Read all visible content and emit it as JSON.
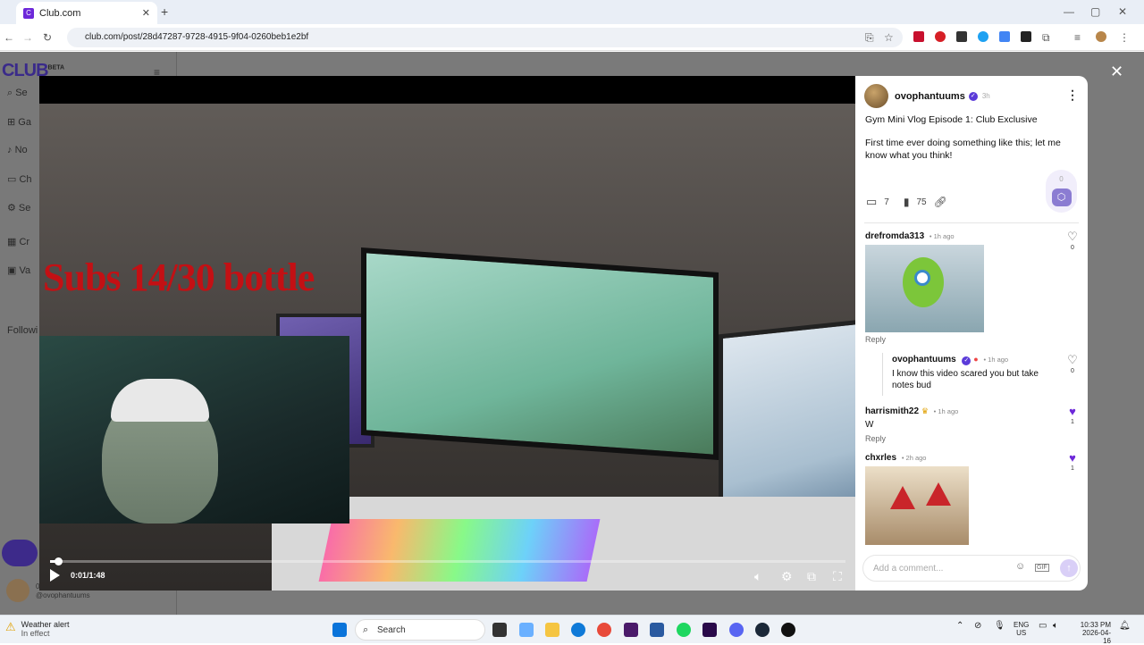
{
  "browser": {
    "tab_title": "Club.com",
    "tab_close": "✕",
    "new_tab": "+",
    "url": "club.com/post/28d47287-9728-4915-9f04-0260beb1e2bf",
    "window_min": "—",
    "window_max": "▢",
    "window_close": "✕"
  },
  "site": {
    "logo": "CLUB",
    "logo_beta": "BETA",
    "sidebar": [
      {
        "label": "Se"
      },
      {
        "label": "Ga"
      },
      {
        "label": "No"
      },
      {
        "label": "Ch"
      },
      {
        "label": "Se"
      },
      {
        "label": "Cr"
      },
      {
        "label": "Va"
      },
      {
        "label": "Followi"
      }
    ],
    "bg_username": "0",
    "bg_handle": "@ovophantuums"
  },
  "video": {
    "overlay_text": "Subs 14/30 bottle",
    "time": "0:01/1:48",
    "progress": 0.01
  },
  "post": {
    "username": "ovophantuums",
    "time_ago": "3h",
    "title": "Gym Mini Vlog Episode 1: Club Exclusive",
    "body": "First time ever doing something like this; let me know what you think!",
    "comment_count": "7",
    "view_count": "75",
    "vote_count": "0"
  },
  "comments": [
    {
      "user": "drefromda313",
      "time": "• 1h ago",
      "likes": "0",
      "reply": "Reply"
    },
    {
      "user": "ovophantuums",
      "time": "• 1h ago",
      "text": "I know this video scared you but take notes bud",
      "likes": "0"
    },
    {
      "user": "harrismith22",
      "time": "• 1h ago",
      "text": "W",
      "likes": "1",
      "reply": "Reply"
    },
    {
      "user": "chxrles",
      "time": "• 2h ago",
      "likes": "1"
    }
  ],
  "add_comment": {
    "placeholder": "Add a comment...",
    "gif": "GIF"
  },
  "taskbar": {
    "weather_title": "Weather alert",
    "weather_sub": "In effect",
    "search": "Search",
    "lang": "ENG",
    "region": "US",
    "time": "10:33 PM",
    "date": "2026-04-16"
  }
}
